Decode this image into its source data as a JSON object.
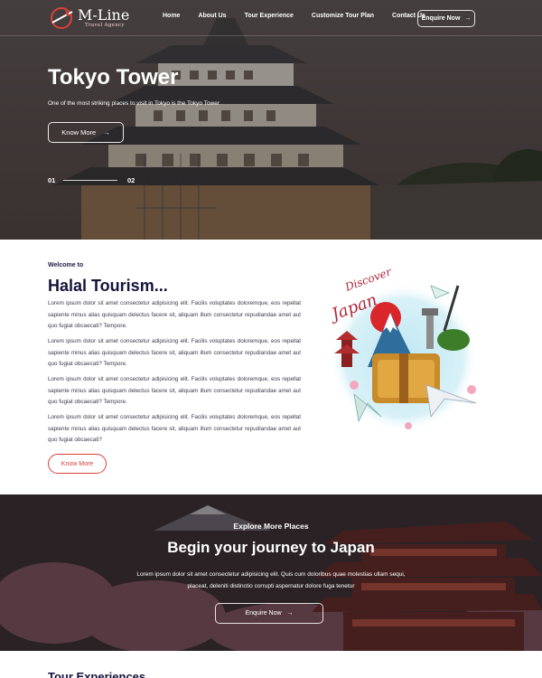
{
  "header": {
    "logo_text": "M-Line",
    "logo_sub": "Travel Agency",
    "menu": [
      "Home",
      "About Us",
      "Tour Experience",
      "Customize Tour Plan",
      "Contact Us"
    ],
    "enquire_label": "Enquire Now",
    "arrow": "→"
  },
  "hero": {
    "title": "Tokyo Tower",
    "subtitle": "One of the most striking places to visit in Tokyo is the Tokyo Tower",
    "button_label": "Know More",
    "slide_current": "01",
    "slide_next": "02"
  },
  "welcome": {
    "kicker": "Welcome to",
    "title": "Halal Tourism...",
    "paragraphs": [
      "Lorem ipsum dolor sit amet consectetur adipisicing elit. Facilis voluptates doloremque, eos repellat sapiente minus alias quisquam delectus facere sit, aliquam illum consectetur repudiandae amet aut quo fugiat obcaecati? Tempore.",
      "Lorem ipsum dolor sit amet consectetur adipisicing elit. Facilis voluptates doloremque, eos repellat sapiente minus alias quisquam delectus facere sit, aliquam illum consectetur repudiandae amet aut quo fugiat obcaecati? Tempore.",
      "Lorem ipsum dolor sit amet consectetur adipisicing elit. Facilis voluptates doloremque, eos repellat sapiente minus alias quisquam delectus facere sit, aliquam illum consectetur repudiandae amet aut quo fugiat obcaecati? Tempore.",
      "Lorem ipsum dolor sit amet consectetur adipisicing elit. Facilis voluptates doloremque, eos repellat sapiente minus alias quisquam delectus facere sit, aliquam illum consectetur repudiandae amet aut quo fugiat obcaecati?"
    ],
    "button_label": "Know More",
    "illustration_text": "Discover Japan"
  },
  "journey": {
    "kicker": "Explore More Places",
    "title": "Begin your journey to Japan",
    "text": "Lorem ipsum dolor sit amet consectetur adipisicing elit. Quis cum doloribus quae molestias ullam sequi, placeat, deleniti distinctio corrupti aspernatur dolore fuga tenetur",
    "button_label": "Enquire Now"
  },
  "next_section": {
    "title": "Tour Experiences"
  },
  "colors": {
    "accent": "#d9413b",
    "navy": "#14143d"
  }
}
